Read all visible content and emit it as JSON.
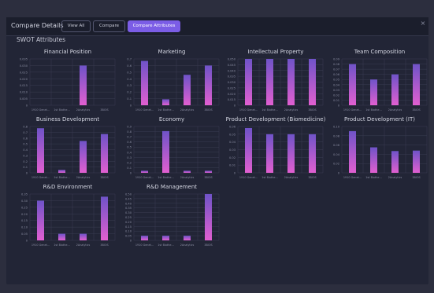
{
  "header": {
    "title": "Compare Details",
    "buttons": [
      {
        "label": "View All"
      },
      {
        "label": "Compare"
      },
      {
        "label": "Compare Attributes"
      }
    ],
    "close_icon": "×"
  },
  "section_title": "SWOT Attributes",
  "colors": {
    "bar_top": "#6f53c8",
    "bar_bottom": "#e15fd0",
    "accent": "#7b5de6",
    "grid": "#3a3d52",
    "tick": "#8a8da2"
  },
  "chart_data": [
    {
      "type": "bar",
      "title": "Financial Position",
      "categories": [
        "1910 Genet...",
        "1st Biothe...",
        "2Analytics",
        "3BIOS"
      ],
      "values": [
        0,
        0,
        0.03,
        0
      ],
      "ylim": [
        0,
        0.035
      ],
      "yticks": [
        "0",
        "0.005",
        "0.010",
        "0.015",
        "0.020",
        "0.025",
        "0.030",
        "0.035"
      ]
    },
    {
      "type": "bar",
      "title": "Marketing",
      "categories": [
        "1910 Genet...",
        "1st Biothe...",
        "2Analytics",
        "3BIOS"
      ],
      "values": [
        0.67,
        0.09,
        0.46,
        0.6
      ],
      "ylim": [
        0,
        0.7
      ],
      "yticks": [
        "0",
        "0.1",
        "0.2",
        "0.3",
        "0.4",
        "0.5",
        "0.6",
        "0.7"
      ]
    },
    {
      "type": "bar",
      "title": "Intellectual Property",
      "categories": [
        "1910 Genet...",
        "1st Biothe...",
        "2Analytics",
        "3BIOS"
      ],
      "values": [
        0.05,
        0.05,
        0.05,
        0.05
      ],
      "ylim": [
        0,
        0.05
      ],
      "yticks": [
        "0",
        "0.015",
        "0.020",
        "0.025",
        "0.030",
        "0.035",
        "0.040",
        "0.045",
        "0.050"
      ]
    },
    {
      "type": "bar",
      "title": "Team Composition",
      "categories": [
        "1910 Genet...",
        "1st Biothe...",
        "2Analytics",
        "3BIOS"
      ],
      "values": [
        0.08,
        0.05,
        0.06,
        0.08
      ],
      "ylim": [
        0,
        0.09
      ],
      "yticks": [
        "0",
        "0.01",
        "0.02",
        "0.03",
        "0.04",
        "0.05",
        "0.06",
        "0.07",
        "0.08",
        "0.09"
      ]
    },
    {
      "type": "bar",
      "title": "Business Development",
      "categories": [
        "1910 Genet...",
        "1st Biothe...",
        "2Analytics",
        "3BIOS"
      ],
      "values": [
        0.77,
        0.05,
        0.55,
        0.67
      ],
      "ylim": [
        0,
        0.8
      ],
      "yticks": [
        "0",
        "0.1",
        "0.2",
        "0.3",
        "0.4",
        "0.5",
        "0.6",
        "0.7",
        "0.8"
      ]
    },
    {
      "type": "bar",
      "title": "Economy",
      "categories": [
        "1910 Genet...",
        "1st Biothe...",
        "2Analytics",
        "3BIOS"
      ],
      "values": [
        0.04,
        0.81,
        0.04,
        0.04
      ],
      "ylim": [
        0,
        0.9
      ],
      "yticks": [
        "0",
        "0.1",
        "0.2",
        "0.3",
        "0.4",
        "0.5",
        "0.6",
        "0.7",
        "0.8",
        "0.9"
      ]
    },
    {
      "type": "bar",
      "title": "Product Development (Biomedicine)",
      "categories": [
        "1910 Genet...",
        "1st Biothe...",
        "2Analytics",
        "3BIOS"
      ],
      "values": [
        0.058,
        0.05,
        0.05,
        0.05
      ],
      "ylim": [
        0,
        0.06
      ],
      "yticks": [
        "0",
        "0.01",
        "0.02",
        "0.03",
        "0.04",
        "0.05",
        "0.06"
      ]
    },
    {
      "type": "bar",
      "title": "Product Development (IT)",
      "categories": [
        "1910 Genet...",
        "1st Biothe...",
        "2Analytics",
        "3BIOS"
      ],
      "values": [
        0.09,
        0.055,
        0.047,
        0.048
      ],
      "ylim": [
        0,
        0.1
      ],
      "yticks": [
        "0",
        "0.02",
        "0.04",
        "0.06",
        "0.08",
        "0.10"
      ]
    },
    {
      "type": "bar",
      "title": "R&D Environment",
      "categories": [
        "1910 Genet...",
        "1st Biothe...",
        "2Analytics",
        "3BIOS"
      ],
      "values": [
        0.3,
        0.05,
        0.05,
        0.33
      ],
      "ylim": [
        0,
        0.35
      ],
      "yticks": [
        "0",
        "0.05",
        "0.10",
        "0.15",
        "0.20",
        "0.25",
        "0.30",
        "0.35"
      ]
    },
    {
      "type": "bar",
      "title": "R&D Management",
      "categories": [
        "1910 Genet...",
        "1st Biothe...",
        "2Analytics",
        "3BIOS"
      ],
      "values": [
        0.05,
        0.05,
        0.05,
        0.5
      ],
      "ylim": [
        0,
        0.5
      ],
      "yticks": [
        "0",
        "0.05",
        "0.10",
        "0.15",
        "0.20",
        "0.25",
        "0.30",
        "0.35",
        "0.40",
        "0.45",
        "0.50"
      ]
    }
  ]
}
